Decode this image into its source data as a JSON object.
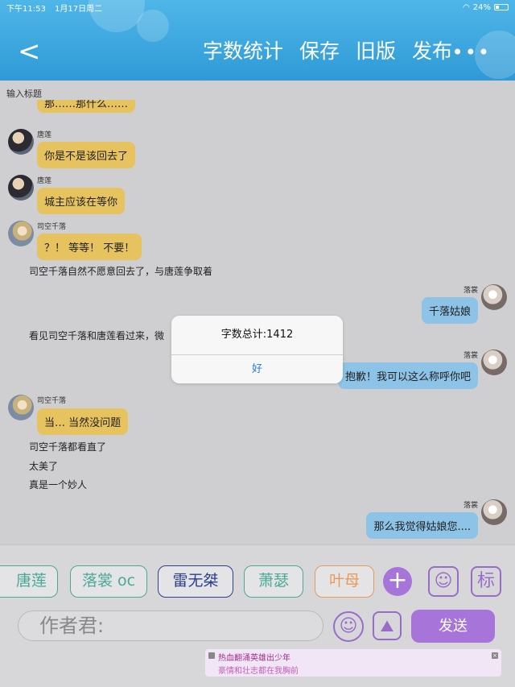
{
  "status_bar": {
    "time": "下午11:53",
    "date": "1月17日周二",
    "battery": "24%"
  },
  "header": {
    "back_icon": "chevron-left-icon",
    "actions": [
      "字数统计",
      "保存",
      "旧版",
      "发布"
    ],
    "more": "•••",
    "color": "#2f9ad6"
  },
  "title_input": {
    "placeholder": "输入标题"
  },
  "chat": {
    "partial_top_text": "那……那什么……",
    "messages": [
      {
        "name": "唐莲",
        "text": "你是不是该回去了"
      },
      {
        "name": "唐莲",
        "text": "城主应该在等你"
      },
      {
        "name": "司空千落",
        "text": "？！ 等等！ 不要！"
      },
      {
        "narration": "司空千落自然不愿意回去了，与唐莲争取着"
      },
      {
        "name": "落裳",
        "text": "千落姑娘"
      },
      {
        "narration": "看见司空千落和唐莲看过来，微"
      },
      {
        "name": "落裳",
        "text": "抱歉！我可以这么称呼你吧"
      },
      {
        "name": "司空千落",
        "text": "当… 当然没问题"
      },
      {
        "narration": "司空千落都看直了"
      },
      {
        "narration": "太美了"
      },
      {
        "narration": "真是一个妙人"
      },
      {
        "name": "落裳",
        "text": "那么我觉得姑娘您...."
      }
    ]
  },
  "alert": {
    "message": "字数总计:1412",
    "ok": "好"
  },
  "characters": [
    {
      "name": "唐莲",
      "color": "#4aa897"
    },
    {
      "name": "落裳 oc",
      "color": "#4aa897"
    },
    {
      "name": "雷无桀",
      "color": "#2b3f8f"
    },
    {
      "name": "萧瑟",
      "color": "#4aa897"
    },
    {
      "name": "叶母",
      "color": "#e89a5c"
    }
  ],
  "toolbar": {
    "add_icon": "plus-icon",
    "role_icon": "person-card-icon",
    "tag_icon": "tag-icon",
    "tag_label": "标",
    "input_placeholder": "作者君:",
    "emoji_icon": "emoji-icon",
    "image_icon": "image-icon",
    "send_label": "发送",
    "accent": "#a774d9"
  },
  "notification": {
    "title": "热血翻涌英雄出少年",
    "subtitle": "豪情和壮志都在我胸前"
  }
}
